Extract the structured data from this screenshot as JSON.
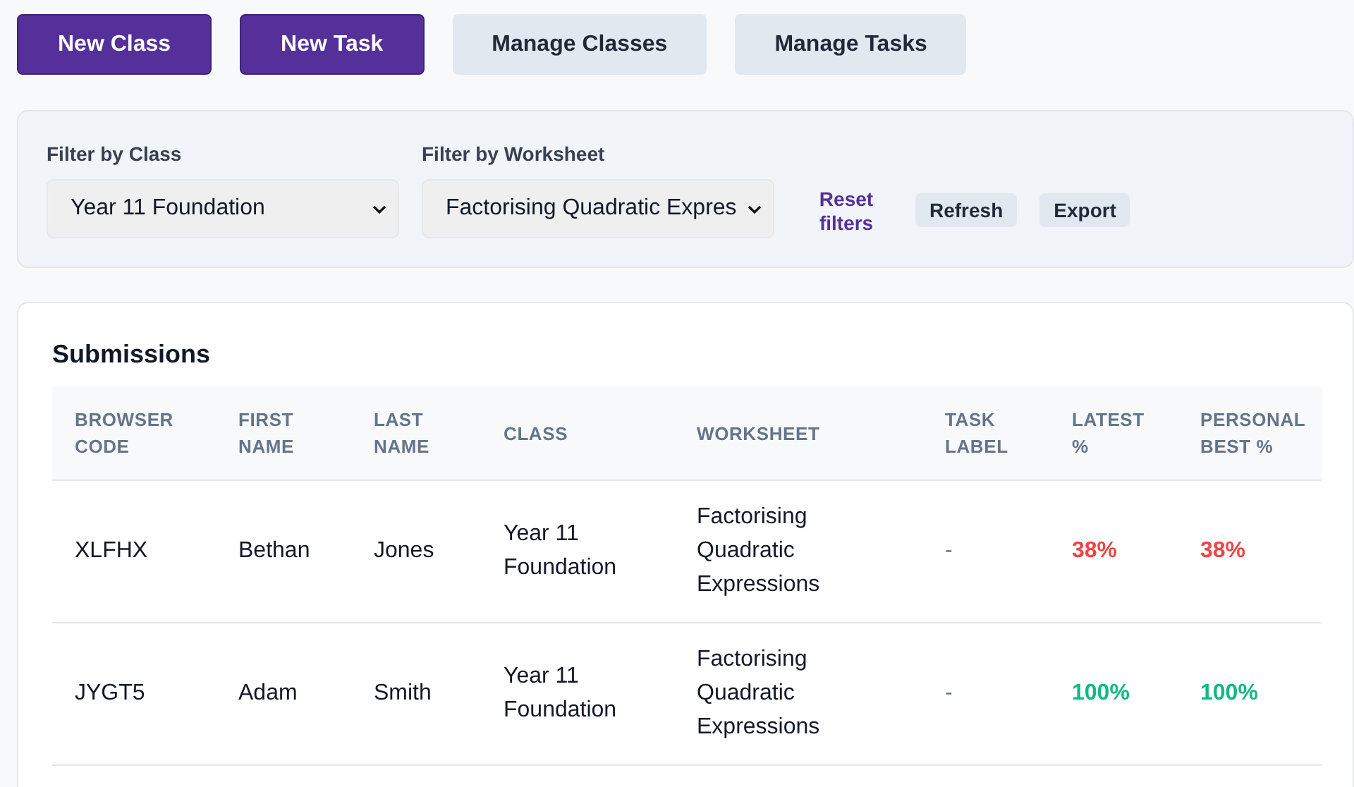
{
  "actions": [
    {
      "label": "New Class",
      "kind": "primary"
    },
    {
      "label": "New Task",
      "kind": "primary"
    },
    {
      "label": "Manage Classes",
      "kind": "secondary"
    },
    {
      "label": "Manage Tasks",
      "kind": "secondary"
    }
  ],
  "filters": {
    "class": {
      "label": "Filter by Class",
      "value": "Year 11 Foundation"
    },
    "worksheet": {
      "label": "Filter by Worksheet",
      "value": "Factorising Quadratic Expres"
    },
    "reset": "Reset filters",
    "buttons": [
      "Refresh",
      "Export"
    ]
  },
  "submissions": {
    "title": "Submissions",
    "columns": [
      "BROWSER CODE",
      "FIRST NAME",
      "LAST NAME",
      "CLASS",
      "WORKSHEET",
      "TASK LABEL",
      "LATEST %",
      "PERSONAL BEST %"
    ],
    "rows": [
      {
        "code": "XLFHX",
        "first": "Bethan",
        "last": "Jones",
        "class": "Year 11 Foundation",
        "worksheet": "Factorising Quadratic Expressions",
        "task": "-",
        "latest": {
          "text": "38%",
          "color": "#ef4444"
        },
        "best": {
          "text": "38%",
          "color": "#ef4444"
        }
      },
      {
        "code": "JYGT5",
        "first": "Adam",
        "last": "Smith",
        "class": "Year 11 Foundation",
        "worksheet": "Factorising Quadratic Expressions",
        "task": "-",
        "latest": {
          "text": "100%",
          "color": "#10b981"
        },
        "best": {
          "text": "100%",
          "color": "#10b981"
        }
      }
    ]
  }
}
